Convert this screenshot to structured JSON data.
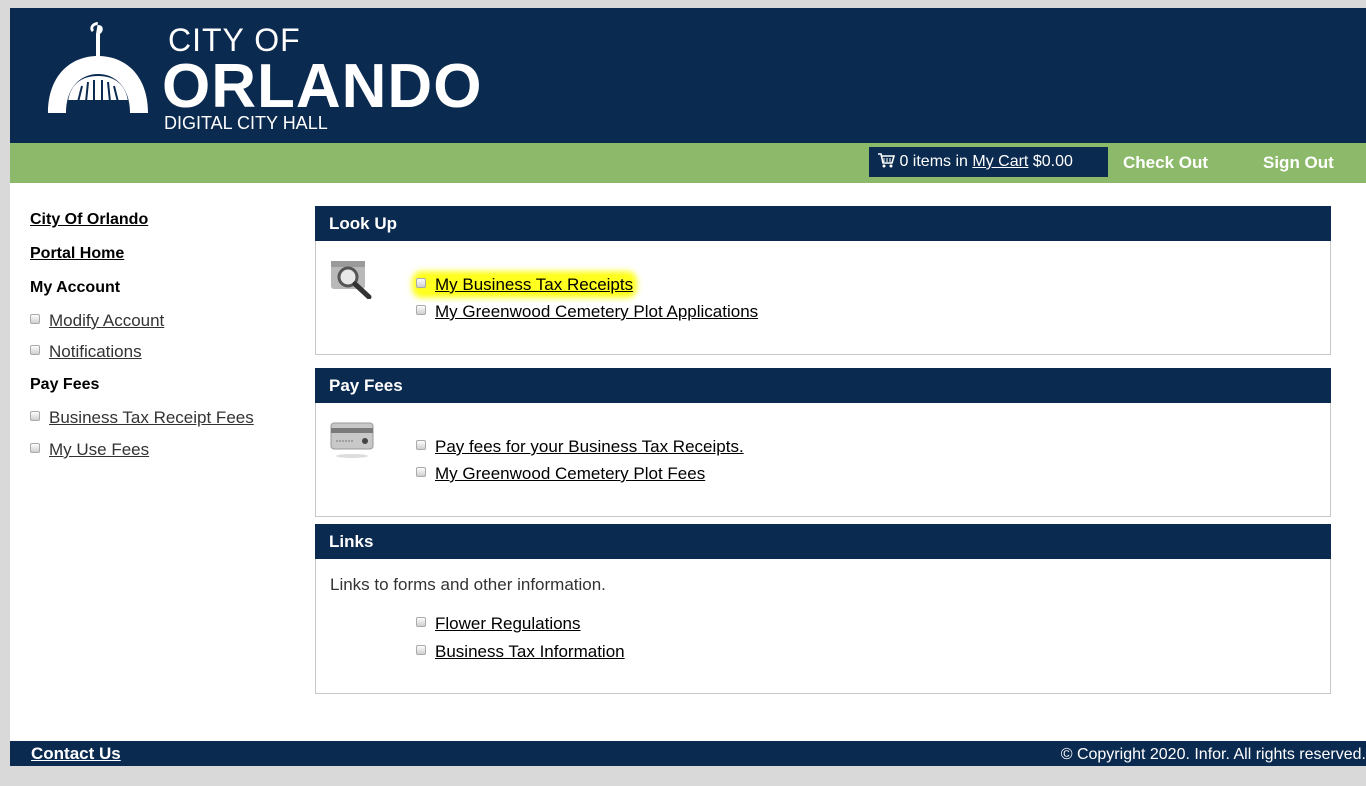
{
  "header": {
    "logo_line1": "CITY OF",
    "logo_line2": "ORLANDO",
    "logo_line3": "DIGITAL CITY HALL"
  },
  "topbar": {
    "cart_prefix": "0 items in",
    "cart_link": "My Cart",
    "cart_total": "$0.00",
    "checkout": "Check Out",
    "signout": "Sign Out"
  },
  "sidebar": {
    "city": "City Of Orlando",
    "portal_home": "Portal Home",
    "my_account": "My Account",
    "account_items": [
      "Modify Account",
      "Notifications"
    ],
    "pay_fees": "Pay Fees",
    "fee_items": [
      "Business Tax Receipt Fees",
      "My Use Fees"
    ]
  },
  "panels": {
    "lookup": {
      "title": "Look Up",
      "links": [
        "My Business Tax Receipts",
        "My Greenwood Cemetery Plot Applications"
      ]
    },
    "payfees": {
      "title": "Pay Fees",
      "links": [
        "Pay fees for your Business Tax Receipts.",
        "My Greenwood Cemetery Plot Fees"
      ]
    },
    "links": {
      "title": "Links",
      "intro": "Links to forms and other information.",
      "links": [
        "Flower Regulations",
        "Business Tax Information"
      ]
    }
  },
  "footer": {
    "contact": "Contact Us",
    "copyright": "© Copyright 2020. Infor. All rights reserved."
  },
  "colors": {
    "navy": "#0b2a4f",
    "green": "#8cba6a",
    "highlight": "#ffff20"
  }
}
